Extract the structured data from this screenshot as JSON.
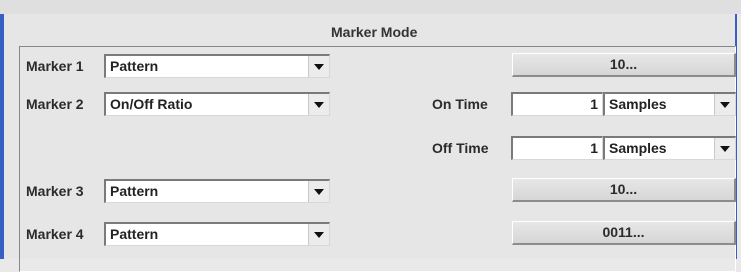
{
  "group_title": "Marker Mode",
  "markers": [
    {
      "label": "Marker 1",
      "mode": "Pattern",
      "button": "10..."
    },
    {
      "label": "Marker 2",
      "mode": "On/Off Ratio",
      "on_time": {
        "label": "On Time",
        "value": "1",
        "unit": "Samples"
      },
      "off_time": {
        "label": "Off Time",
        "value": "1",
        "unit": "Samples"
      }
    },
    {
      "label": "Marker 3",
      "mode": "Pattern",
      "button": "10..."
    },
    {
      "label": "Marker 4",
      "mode": "Pattern",
      "button": "0011..."
    }
  ]
}
